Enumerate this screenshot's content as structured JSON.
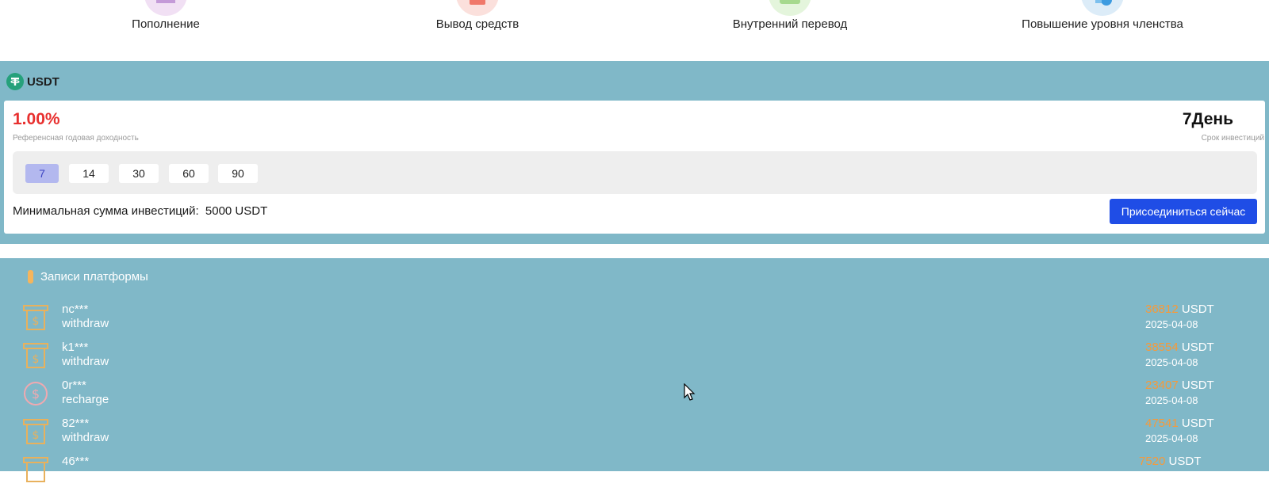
{
  "top_actions": [
    {
      "label": "Пополнение",
      "icon": "deposit-icon",
      "color": "#f1e0f4"
    },
    {
      "label": "Вывод средств",
      "icon": "withdraw-icon",
      "color": "#fbe0dc"
    },
    {
      "label": "Внутренний перевод",
      "icon": "transfer-icon",
      "color": "#e4f5dc"
    },
    {
      "label": "Повышение уровня членства",
      "icon": "upgrade-icon",
      "color": "#dcecf8"
    }
  ],
  "product": {
    "coin": "USDT",
    "rate": "1.00%",
    "rate_label": "Референсная годовая доходность",
    "term": "7День",
    "term_label": "Срок инвестиций",
    "days": [
      "7",
      "14",
      "30",
      "60",
      "90"
    ],
    "selected_day": "7",
    "min_amount_label": "Минимальная сумма инвестиций:",
    "min_amount_value": "5000 USDT",
    "join_label": "Присоединиться сейчас"
  },
  "records": {
    "title": "Записи платформы",
    "items": [
      {
        "user": "nc***",
        "type": "withdraw",
        "amount": "36812",
        "unit": "USDT",
        "date": "2025-04-08",
        "icon": "atm-cash-icon"
      },
      {
        "user": "k1***",
        "type": "withdraw",
        "amount": "38554",
        "unit": "USDT",
        "date": "2025-04-08",
        "icon": "atm-cash-icon"
      },
      {
        "user": "0r***",
        "type": "recharge",
        "amount": "23407",
        "unit": "USDT",
        "date": "2025-04-08",
        "icon": "dollar-coin-icon"
      },
      {
        "user": "82***",
        "type": "withdraw",
        "amount": "47541",
        "unit": "USDT",
        "date": "2025-04-08",
        "icon": "atm-cash-icon"
      },
      {
        "user": "46***",
        "type": "",
        "amount": "7520",
        "unit": "USDT",
        "date": "",
        "icon": "atm-cash-icon"
      }
    ]
  },
  "colors": {
    "accent_blue": "#1f4de6",
    "rate_red": "#e8302f",
    "amount_orange": "#f59a3b",
    "section_bg": "#80b8c8"
  }
}
